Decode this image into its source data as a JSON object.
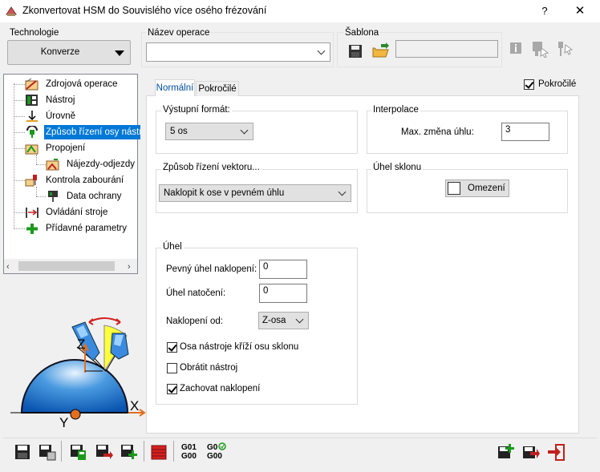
{
  "window": {
    "title": "Zkonvertovat HSM do Souvislého více osého frézování",
    "help": "?",
    "close": "✕"
  },
  "technology": {
    "label": "Technologie",
    "value": "Konverze"
  },
  "operation_name": {
    "label": "Název operace",
    "value": ""
  },
  "template": {
    "label": "Šablona",
    "value": ""
  },
  "tree": {
    "items": [
      {
        "label": "Zdrojová operace"
      },
      {
        "label": "Nástroj"
      },
      {
        "label": "Úrovně"
      },
      {
        "label": "Způsob řízení osy nástro"
      },
      {
        "label": "Propojení"
      },
      {
        "label": "Nájezdy-odjezdy"
      },
      {
        "label": "Kontrola zabourání"
      },
      {
        "label": "Data ochrany"
      },
      {
        "label": "Ovládání stroje"
      },
      {
        "label": "Přídavné parametry"
      }
    ]
  },
  "diagram": {
    "z_label": "Z",
    "x_label": "X",
    "y_label": "Y"
  },
  "tabs": [
    {
      "label": "Normální"
    },
    {
      "label": "Pokročilé"
    }
  ],
  "advanced_checkbox": {
    "label": "Pokročilé",
    "checked": true
  },
  "output_format": {
    "group": "Výstupní formát:",
    "value": "5 os"
  },
  "interpolation": {
    "group": "Interpolace",
    "max_angle_label": "Max. změna úhlu:",
    "max_angle_value": "3"
  },
  "vector_control": {
    "group": "Způsob řízení vektoru...",
    "value": "Naklopit k ose v pevném úhlu"
  },
  "tilt_angle_group": {
    "group": "Úhel sklonu",
    "limit_button": "Omezení"
  },
  "angle": {
    "group": "Úhel",
    "fixed_tilt_label": "Pevný úhel naklopení:",
    "fixed_tilt_value": "0",
    "rotation_label": "Úhel natočení:",
    "rotation_value": "0",
    "tilt_from_label": "Naklopení od:",
    "tilt_from_value": "Z-osa",
    "options": [
      {
        "label": "Osa nástroje kříží osu sklonu",
        "checked": true
      },
      {
        "label": "Obrátit nástroj",
        "checked": false
      },
      {
        "label": "Zachovat naklopení",
        "checked": true
      }
    ]
  },
  "bottom_toolbar": {
    "g01": "G01",
    "g00a": "G00",
    "g0": "G0",
    "g00b": "G00"
  },
  "colors": {
    "selection": "#0078d7",
    "accent_red": "#d42020",
    "accent_green": "#1a9a1a"
  }
}
